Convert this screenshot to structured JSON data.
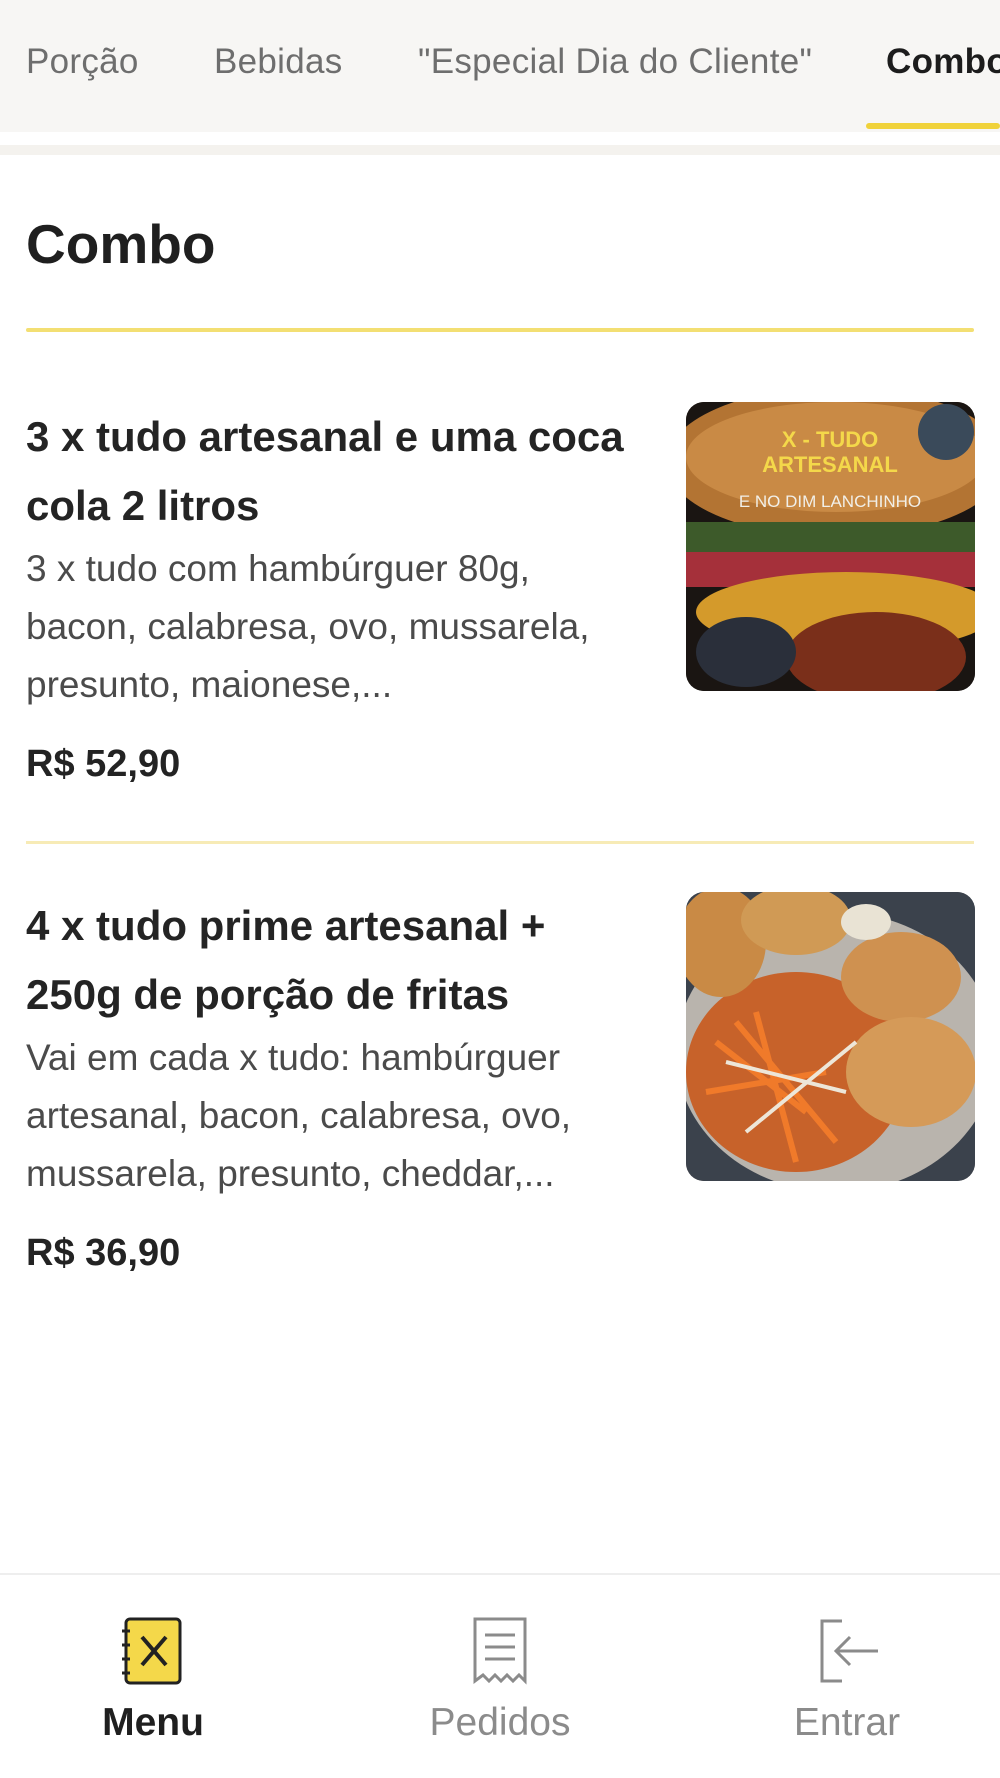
{
  "tabs": [
    {
      "label": "Porção"
    },
    {
      "label": "Bebidas"
    },
    {
      "label": "\"Especial Dia do Cliente\""
    },
    {
      "label": "Combo"
    }
  ],
  "section": {
    "title": "Combo"
  },
  "items": [
    {
      "name": "3 x tudo artesanal e uma coca cola 2 litros",
      "description": "3 x tudo com hambúrguer 80g, bacon, calabresa, ovo, mussarela, presunto, maionese,...",
      "price": "R$ 52,90",
      "photo_text": [
        "X - TUDO",
        "ARTESANAL",
        "E NO DIM LANCHINHO"
      ]
    },
    {
      "name": "4 x tudo prime artesanal + 250g de porção de fritas",
      "description": "Vai em cada x tudo: hambúrguer artesanal, bacon, calabresa, ovo, mussarela, presunto, cheddar,...",
      "price": "R$ 36,90"
    }
  ],
  "bottom_nav": [
    {
      "label": "Menu",
      "icon": "menu-book-icon",
      "active": true
    },
    {
      "label": "Pedidos",
      "icon": "receipt-icon",
      "active": false
    },
    {
      "label": "Entrar",
      "icon": "login-icon",
      "active": false
    }
  ],
  "colors": {
    "accent": "#f0d23a",
    "accent_light": "#f3df73",
    "text": "#242424",
    "muted": "#8b8b8b"
  }
}
